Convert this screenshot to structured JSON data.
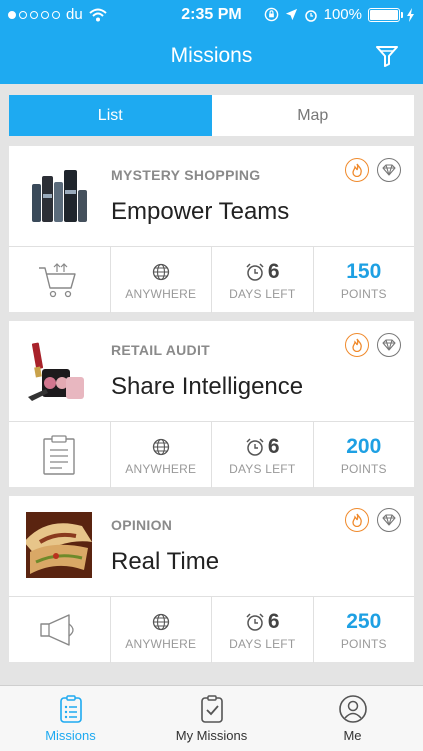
{
  "status": {
    "carrier": "du",
    "time": "2:35 PM",
    "battery": "100%"
  },
  "nav": {
    "title": "Missions"
  },
  "segment": {
    "list": "List",
    "map": "Map"
  },
  "missions": [
    {
      "category": "MYSTERY SHOPPING",
      "name": "Empower Teams",
      "location": "ANYWHERE",
      "days": "6",
      "days_label": "DAYS LEFT",
      "points": "150",
      "points_label": "POINTS",
      "type_icon": "cart-icon"
    },
    {
      "category": "RETAIL AUDIT",
      "name": "Share Intelligence",
      "location": "ANYWHERE",
      "days": "6",
      "days_label": "DAYS LEFT",
      "points": "200",
      "points_label": "POINTS",
      "type_icon": "clipboard-icon"
    },
    {
      "category": "OPINION",
      "name": "Real Time",
      "location": "ANYWHERE",
      "days": "6",
      "days_label": "DAYS LEFT",
      "points": "250",
      "points_label": "POINTS",
      "type_icon": "megaphone-icon"
    }
  ],
  "tabs": {
    "missions": "Missions",
    "my_missions": "My Missions",
    "me": "Me"
  },
  "colors": {
    "accent": "#1eaaf1",
    "fire": "#f08a2c",
    "points": "#1ea0e3"
  }
}
